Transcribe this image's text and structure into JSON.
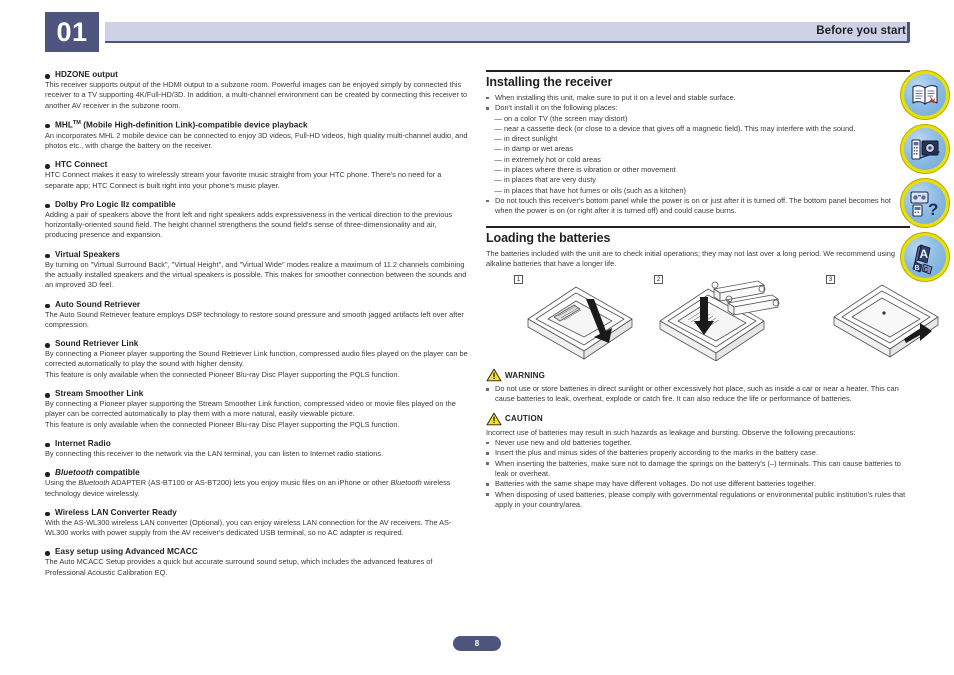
{
  "header": {
    "chapter_number": "01",
    "section_title": "Before you start",
    "accent_color": "#4d557f",
    "bar_color": "#ccd1e8"
  },
  "footer": {
    "page_number": "8"
  },
  "left_column": {
    "features": [
      {
        "title": "HDZONE output",
        "paragraphs": [
          "This receiver supports output of the HDMI output to a subzone room. Powerful images can be enjoyed simply by connected this receiver to a TV supporting 4K/Full-HD/3D. In addition, a multi-channel environment can be created by connecting this receiver to another AV receiver in the subzone room."
        ]
      },
      {
        "title": "MHL",
        "title_sup": "TM",
        "title_rest": " (Mobile High-definition Link)-compatible device playback",
        "paragraphs": [
          "An incorporates MHL 2 mobile device can be connected to enjoy 3D videos, Full-HD videos, high quality multi-channel audio, and photos etc., with charge the battery on the receiver."
        ]
      },
      {
        "title": "HTC Connect",
        "paragraphs": [
          "HTC Connect makes it easy to wirelessly stream your favorite music straight from your HTC phone. There's no need for a separate app; HTC Connect is built right into your phone's music player."
        ]
      },
      {
        "title": "Dolby Pro Logic IIz compatible",
        "paragraphs": [
          "Adding a pair of speakers above the front left and right speakers adds expressiveness in the vertical direction to the previous horizontally-oriented sound field. The height channel strengthens the sound field's sense of three-dimensionality and air, producing presence and expansion."
        ]
      },
      {
        "title": "Virtual Speakers",
        "paragraphs": [
          "By turning on \"Virtual Surround Back\", \"Virtual Height\", and \"Virtual Wide\" modes realize a maximum of 11.2 channels combining the actually installed speakers and the virtual speakers is possible. This makes for smoother connection between the sounds and an improved 3D feel."
        ]
      },
      {
        "title": "Auto Sound Retriever",
        "paragraphs": [
          "The Auto Sound Retriever feature employs DSP technology to restore sound pressure and smooth jagged artifacts left over after compression."
        ]
      },
      {
        "title": "Sound Retriever Link",
        "paragraphs": [
          "By connecting a Pioneer player supporting the Sound Retriever Link function, compressed audio files played on the player can be corrected automatically to play the sound with higher density.",
          "This feature is only available when the connected Pioneer Blu-ray Disc Player supporting the PQLS function."
        ]
      },
      {
        "title": "Stream Smoother Link",
        "paragraphs": [
          "By connecting a Pioneer player supporting the Stream Smoother Link function, compressed video or movie files played on the player can be corrected automatically to play them with a more natural, easily viewable picture.",
          "This feature is only available when the connected Pioneer Blu-ray Disc Player supporting the PQLS function."
        ]
      },
      {
        "title": "Internet Radio",
        "paragraphs": [
          "By connecting this receiver to the network via the LAN terminal, you can listen to Internet radio stations."
        ]
      },
      {
        "title_italic": "Bluetooth",
        "title_rest2": " compatible",
        "paragraphs": [
          "Using the Bluetooth ADAPTER (AS-BT100 or AS-BT200) lets you enjoy music files on an iPhone or other Bluetooth wireless technology device wirelessly."
        ]
      },
      {
        "title": "Wireless LAN Converter Ready",
        "paragraphs": [
          "With the AS-WL300 wireless LAN converter (Optional), you can enjoy wireless LAN connection for the AV receivers. The AS-WL300 works with power supply from the AV receiver's dedicated USB terminal, so no AC adapter is required."
        ]
      },
      {
        "title": "Easy setup using Advanced MCACC",
        "paragraphs": [
          "The Auto MCACC Setup provides a quick but accurate surround sound setup, which includes the advanced features of Professional Acoustic Calibration EQ."
        ]
      }
    ]
  },
  "right_column": {
    "installing": {
      "heading": "Installing the receiver",
      "bullets": [
        "When installing this unit, make sure to put it on a level and stable surface.",
        "Don't install it on the following places:"
      ],
      "dashes": [
        "— on a color TV (the screen may distort)",
        "— near a cassette deck (or close to a device that gives off a magnetic field). This may interfere with the sound.",
        "— in direct sunlight",
        "— in damp or wet areas",
        "— in extremely hot or cold areas",
        "— in places where there is vibration or other movement",
        "— in places that are very dusty",
        "— in places that have hot fumes or oils (such as a kitchen)"
      ],
      "bullets_after": [
        "Do not touch this receiver's bottom panel while the power is on or just after it is turned off. The bottom panel becomes hot when the power is on (or right after it is turned off) and could cause burns."
      ]
    },
    "loading": {
      "heading": "Loading the batteries",
      "intro": "The batteries included with the unit are to check initial operations; they may not last over a long period. We recommend using alkaline batteries that have a longer life.",
      "steps": [
        "1",
        "2",
        "3"
      ]
    },
    "warning": {
      "label": "WARNING",
      "items": [
        "Do not use or store batteries in direct sunlight or other excessively hot place, such as inside a car or near a heater. This can cause batteries to leak, overheat, explode or catch fire. It can also reduce the life or performance of batteries."
      ]
    },
    "caution": {
      "label": "CAUTION",
      "intro": "Incorrect use of batteries may result in such hazards as leakage and bursting. Observe the following precautions:",
      "items": [
        "Never use new and old batteries together.",
        "Insert the plus and minus sides of the batteries properly according to the marks in the battery case.",
        "When inserting the batteries, make sure not to damage the springs on the battery's (–) terminals. This can cause batteries to leak or overheat.",
        "Batteries with the same shape may have different voltages. Do not use different batteries together.",
        "When disposing of used batteries, please comply with governmental regulations or environmental public institution's rules that apply in your country/area."
      ]
    }
  },
  "rail_icons": [
    {
      "name": "manual-book-icon",
      "alt": "Operating instructions"
    },
    {
      "name": "connections-icon",
      "alt": "Connections guide"
    },
    {
      "name": "faq-icon",
      "alt": "Frequently asked questions"
    },
    {
      "name": "glossary-icon",
      "alt": "Glossary"
    }
  ]
}
